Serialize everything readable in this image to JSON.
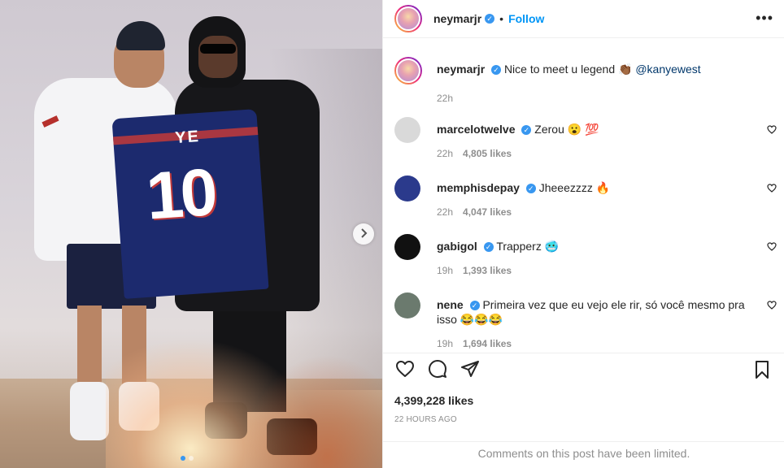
{
  "post": {
    "author": "neymarjr",
    "follow_label": "Follow",
    "separator": "•",
    "more_label": "•••",
    "caption_text": "Nice to meet u legend 👏🏾",
    "caption_mention": "@kanyewest",
    "caption_time": "22h",
    "likes": "4,399,228 likes",
    "posted_ago": "22 HOURS AGO",
    "comments_limited": "Comments on this post have been limited.",
    "jersey_name": "YE",
    "jersey_number": "10",
    "carousel": {
      "total": 2,
      "active": 0
    }
  },
  "comments": [
    {
      "user": "marcelotwelve",
      "verified": true,
      "text": "Zerou 😮 💯",
      "time": "22h",
      "likes": "4,805 likes",
      "avatar_color": "#d9d9d9"
    },
    {
      "user": "memphisdepay",
      "verified": true,
      "text": "Jheeezzzz 🔥",
      "time": "22h",
      "likes": "4,047 likes",
      "avatar_color": "#2b3a8c"
    },
    {
      "user": "gabigol",
      "verified": true,
      "text": "Trapperz 🥶",
      "time": "19h",
      "likes": "1,393 likes",
      "avatar_color": "#111111"
    },
    {
      "user": "nene",
      "verified": true,
      "text": "Primeira vez que eu vejo ele rir, só você mesmo pra isso 😂😂😂",
      "time": "19h",
      "likes": "1,694 likes",
      "avatar_color": "#6b7a6e"
    }
  ],
  "icons": {
    "like": "heart-icon",
    "comment": "comment-icon",
    "share": "share-icon",
    "save": "bookmark-icon",
    "next": "chevron-right-icon",
    "verified": "verified-badge-icon"
  },
  "colors": {
    "accent": "#0095f6",
    "verified": "#3897f0",
    "muted": "#8e8e8e"
  }
}
